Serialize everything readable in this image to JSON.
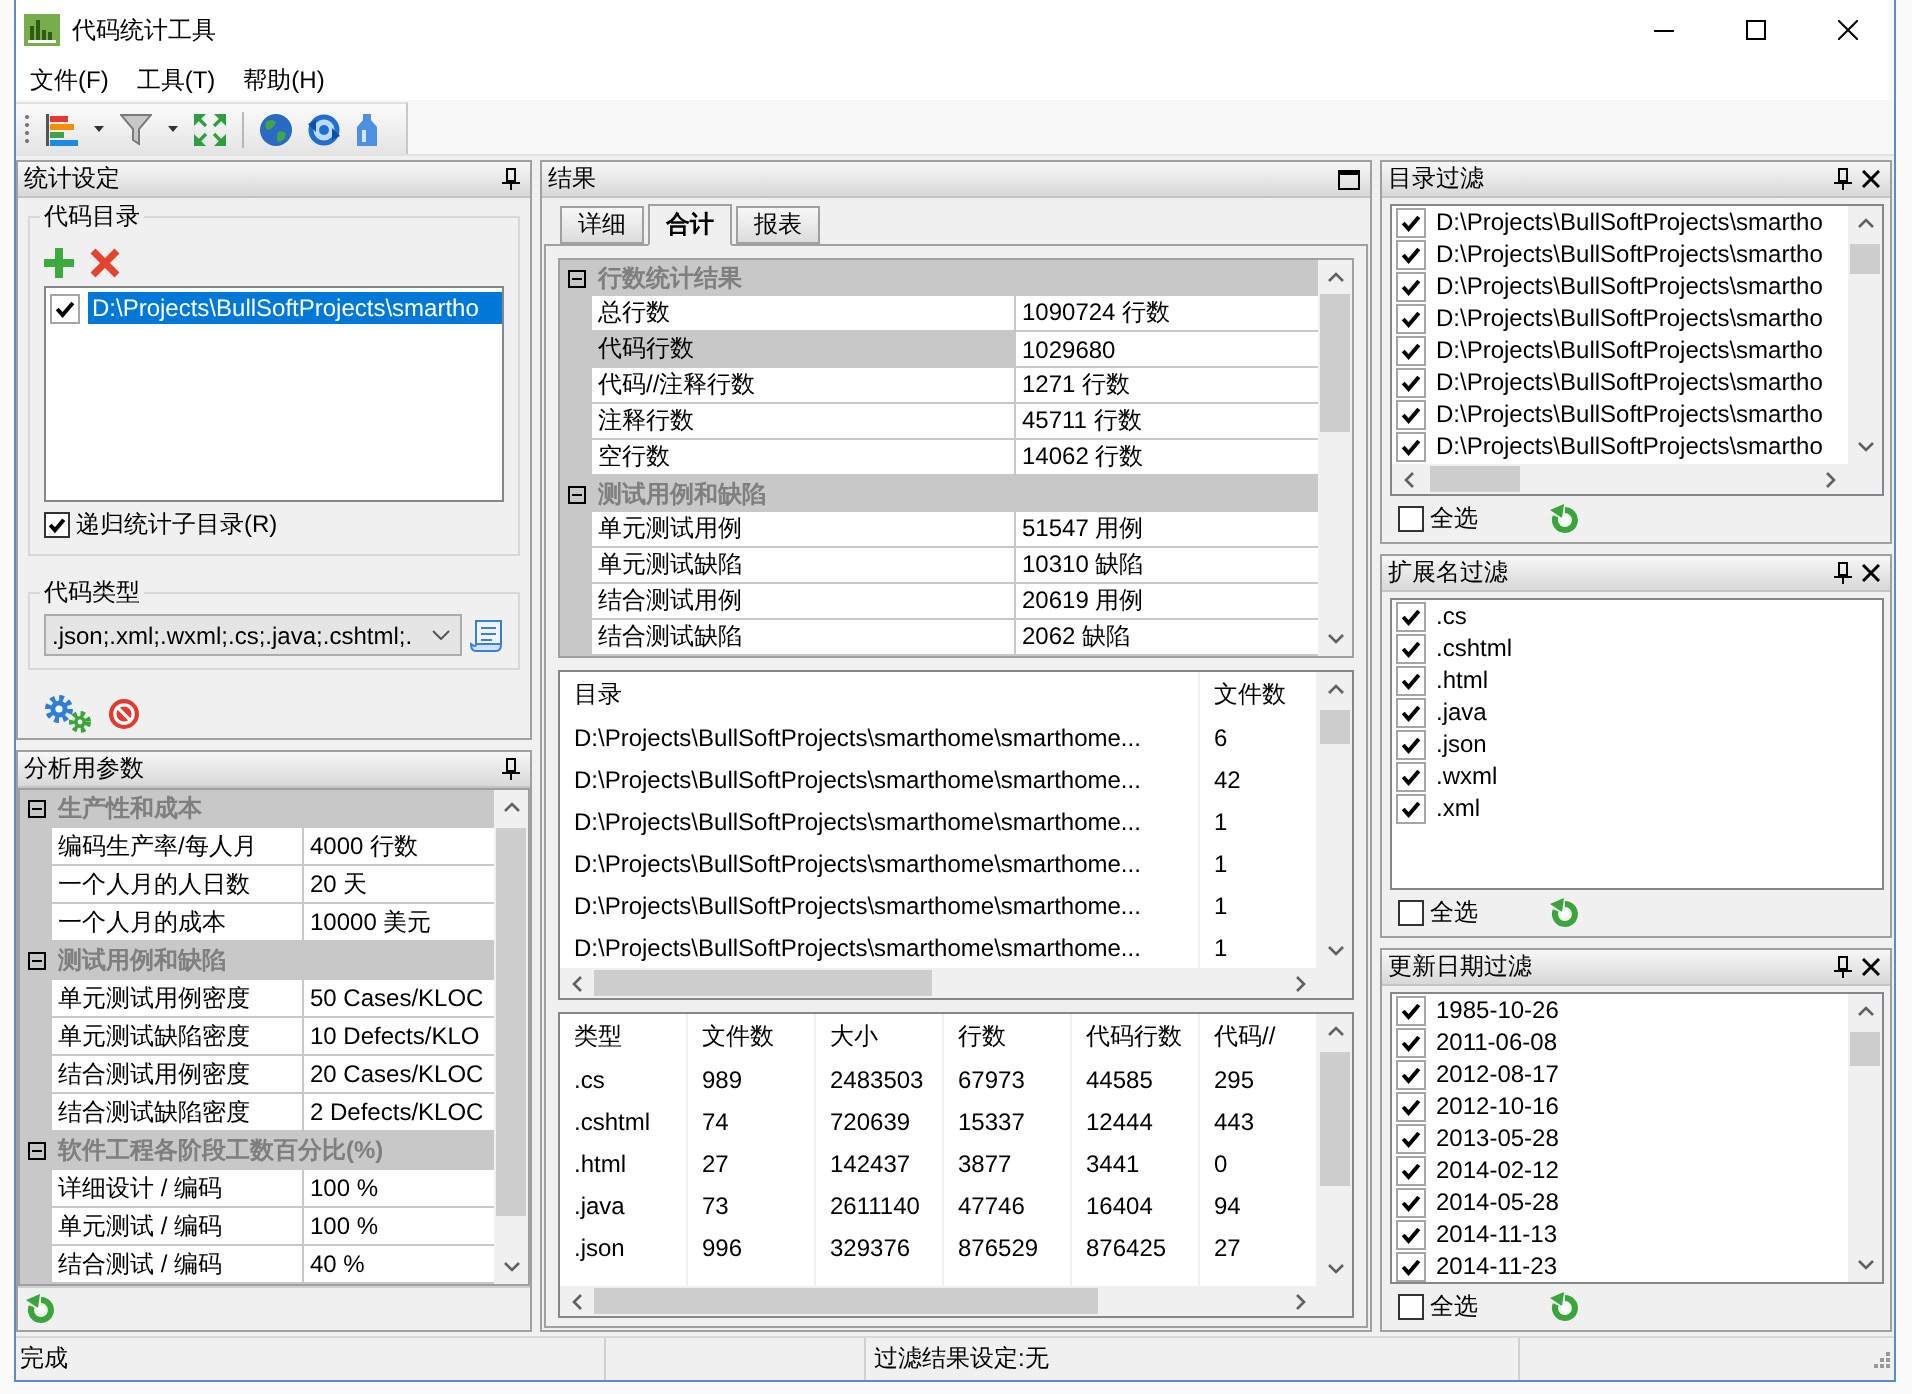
{
  "window": {
    "title": "代码统计工具"
  },
  "menu": [
    {
      "label": "文件(F)"
    },
    {
      "label": "工具(T)"
    },
    {
      "label": "帮助(H)"
    }
  ],
  "settings_panel": {
    "title": "统计设定",
    "directory_group": {
      "label": "代码目录",
      "items": [
        {
          "path": "D:\\Projects\\BullSoftProjects\\smartho",
          "checked": true,
          "selected": true
        }
      ]
    },
    "recursive": {
      "label": "递归统计子目录(R)",
      "checked": true
    },
    "type_group": {
      "label": "代码类型",
      "value": ".json;.xml;.wxml;.cs;.java;.cshtml;."
    }
  },
  "params_panel": {
    "title": "分析用参数",
    "categories": [
      {
        "name": "生产性和成本",
        "expanded": true,
        "rows": [
          {
            "label": "编码生产率/每人月",
            "value": "4000 行数",
            "selected": false
          },
          {
            "label": "一个人月的人日数",
            "value": "20 天",
            "selected": false
          },
          {
            "label": "一个人月的成本",
            "value": "10000 美元",
            "selected": false
          }
        ]
      },
      {
        "name": "测试用例和缺陷",
        "expanded": true,
        "rows": [
          {
            "label": "单元测试用例密度",
            "value": "50 Cases/KLOC",
            "selected": false
          },
          {
            "label": "单元测试缺陷密度",
            "value": "10 Defects/KLO",
            "selected": false
          },
          {
            "label": "结合测试用例密度",
            "value": "20 Cases/KLOC",
            "selected": false
          },
          {
            "label": "结合测试缺陷密度",
            "value": "2 Defects/KLOC",
            "selected": false
          }
        ]
      },
      {
        "name": "软件工程各阶段工数百分比(%)",
        "expanded": true,
        "rows": [
          {
            "label": "详细设计 / 编码",
            "value": "100 %",
            "selected": false
          },
          {
            "label": "单元测试 / 编码",
            "value": "100 %",
            "selected": false
          },
          {
            "label": "结合测试 / 编码",
            "value": "40 %",
            "selected": false
          }
        ]
      }
    ]
  },
  "results_panel": {
    "title": "结果",
    "tabs": [
      {
        "label": "详细",
        "selected": false
      },
      {
        "label": "合计",
        "selected": true
      },
      {
        "label": "报表",
        "selected": false
      }
    ],
    "summary": {
      "categories": [
        {
          "name": "行数统计结果",
          "expanded": true,
          "rows": [
            {
              "label": "总行数",
              "value": "1090724 行数",
              "selected": false
            },
            {
              "label": "代码行数",
              "value": "1029680",
              "selected": true
            },
            {
              "label": "代码//注释行数",
              "value": "1271 行数",
              "selected": false
            },
            {
              "label": "注释行数",
              "value": "45711 行数",
              "selected": false
            },
            {
              "label": "空行数",
              "value": "14062 行数",
              "selected": false
            }
          ]
        },
        {
          "name": "测试用例和缺陷",
          "expanded": true,
          "rows": [
            {
              "label": "单元测试用例",
              "value": "51547 用例",
              "selected": false
            },
            {
              "label": "单元测试缺陷",
              "value": "10310 缺陷",
              "selected": false
            },
            {
              "label": "结合测试用例",
              "value": "20619 用例",
              "selected": false
            },
            {
              "label": "结合测试缺陷",
              "value": "2062 缺陷",
              "selected": false
            }
          ]
        }
      ]
    },
    "directory_table": {
      "columns": [
        "目录",
        "文件数"
      ],
      "rows": [
        [
          "D:\\Projects\\BullSoftProjects\\smarthome\\smarthome...",
          "6"
        ],
        [
          "D:\\Projects\\BullSoftProjects\\smarthome\\smarthome...",
          "42"
        ],
        [
          "D:\\Projects\\BullSoftProjects\\smarthome\\smarthome...",
          "1"
        ],
        [
          "D:\\Projects\\BullSoftProjects\\smarthome\\smarthome...",
          "1"
        ],
        [
          "D:\\Projects\\BullSoftProjects\\smarthome\\smarthome...",
          "1"
        ],
        [
          "D:\\Projects\\BullSoftProjects\\smarthome\\smarthome...",
          "1"
        ]
      ]
    },
    "type_table": {
      "columns": [
        "类型",
        "文件数",
        "大小",
        "行数",
        "代码行数",
        "代码//"
      ],
      "rows": [
        [
          ".cs",
          "989",
          "2483503",
          "67973",
          "44585",
          "295"
        ],
        [
          ".cshtml",
          "74",
          "720639",
          "15337",
          "12444",
          "443"
        ],
        [
          ".html",
          "27",
          "142437",
          "3877",
          "3441",
          "0"
        ],
        [
          ".java",
          "73",
          "2611140",
          "47746",
          "16404",
          "94"
        ],
        [
          ".json",
          "996",
          "329376",
          "876529",
          "876425",
          "27"
        ]
      ]
    }
  },
  "filters": [
    {
      "title": "目录过滤",
      "items": [
        {
          "label": "D:\\Projects\\BullSoftProjects\\smartho",
          "checked": true
        },
        {
          "label": "D:\\Projects\\BullSoftProjects\\smartho",
          "checked": true
        },
        {
          "label": "D:\\Projects\\BullSoftProjects\\smartho",
          "checked": true
        },
        {
          "label": "D:\\Projects\\BullSoftProjects\\smartho",
          "checked": true
        },
        {
          "label": "D:\\Projects\\BullSoftProjects\\smartho",
          "checked": true
        },
        {
          "label": "D:\\Projects\\BullSoftProjects\\smartho",
          "checked": true
        },
        {
          "label": "D:\\Projects\\BullSoftProjects\\smartho",
          "checked": true
        },
        {
          "label": "D:\\Projects\\BullSoftProjects\\smartho",
          "checked": true
        }
      ],
      "select_all": {
        "label": "全选",
        "checked": false
      }
    },
    {
      "title": "扩展名过滤",
      "items": [
        {
          "label": ".cs",
          "checked": true
        },
        {
          "label": ".cshtml",
          "checked": true
        },
        {
          "label": ".html",
          "checked": true
        },
        {
          "label": ".java",
          "checked": true
        },
        {
          "label": ".json",
          "checked": true
        },
        {
          "label": ".wxml",
          "checked": true
        },
        {
          "label": ".xml",
          "checked": true
        }
      ],
      "select_all": {
        "label": "全选",
        "checked": false
      }
    },
    {
      "title": "更新日期过滤",
      "items": [
        {
          "label": "1985-10-26",
          "checked": true
        },
        {
          "label": "2011-06-08",
          "checked": true
        },
        {
          "label": "2012-08-17",
          "checked": true
        },
        {
          "label": "2012-10-16",
          "checked": true
        },
        {
          "label": "2013-05-28",
          "checked": true
        },
        {
          "label": "2014-02-12",
          "checked": true
        },
        {
          "label": "2014-05-28",
          "checked": true
        },
        {
          "label": "2014-11-13",
          "checked": true
        },
        {
          "label": "2014-11-23",
          "checked": true
        }
      ],
      "select_all": {
        "label": "全选",
        "checked": false
      }
    }
  ],
  "status_bar": {
    "message": "完成",
    "filter_info": "过滤结果设定:无"
  }
}
